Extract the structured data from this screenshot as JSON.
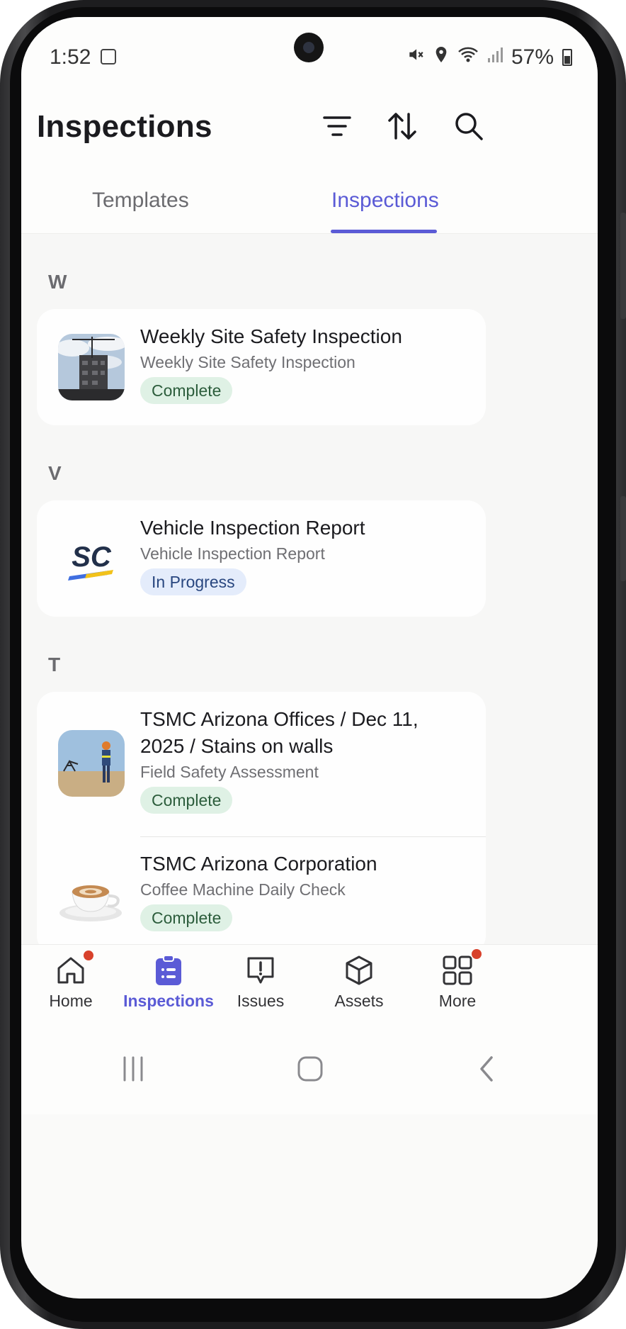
{
  "status_bar": {
    "time": "1:52",
    "battery": "57%"
  },
  "header": {
    "title": "Inspections",
    "icons": [
      "filter-icon",
      "sort-icon",
      "search-icon"
    ]
  },
  "tabs": [
    {
      "label": "Templates",
      "active": false
    },
    {
      "label": "Inspections",
      "active": true
    }
  ],
  "sections": [
    {
      "letter": "W",
      "items": [
        {
          "title": "Weekly Site Safety Inspection",
          "subtitle": "Weekly Site Safety Inspection",
          "status": "Complete",
          "thumbnail": "construction-site-photo"
        }
      ]
    },
    {
      "letter": "V",
      "items": [
        {
          "title": "Vehicle Inspection Report",
          "subtitle": "Vehicle Inspection Report",
          "status": "In Progress",
          "thumbnail": "sc-logo"
        }
      ]
    },
    {
      "letter": "T",
      "items": [
        {
          "title_line1": "TSMC Arizona Offices / Dec 11,",
          "title_line2": "2025 / Stains on walls",
          "subtitle": "Field Safety Assessment",
          "status": "Complete",
          "thumbnail": "oilfield-worker-photo"
        },
        {
          "title": "TSMC Arizona Corporation",
          "subtitle": "Coffee Machine Daily Check",
          "status": "Complete",
          "thumbnail": "coffee-cup-photo"
        }
      ]
    }
  ],
  "bottom_nav": [
    {
      "label": "Home",
      "icon": "home-icon",
      "active": false,
      "notification": true
    },
    {
      "label": "Inspections",
      "icon": "clipboard-icon",
      "active": true,
      "notification": false
    },
    {
      "label": "Issues",
      "icon": "issue-alert-icon",
      "active": false,
      "notification": false
    },
    {
      "label": "Assets",
      "icon": "cube-icon",
      "active": false,
      "notification": false
    },
    {
      "label": "More",
      "icon": "grid-icon",
      "active": false,
      "notification": true
    }
  ],
  "colors": {
    "accent": "#5b5bd6",
    "complete_bg": "#dff1e5",
    "complete_text": "#2c5d3c",
    "progress_bg": "#e4ecfb",
    "progress_text": "#28467f",
    "notification": "#d8412b"
  }
}
